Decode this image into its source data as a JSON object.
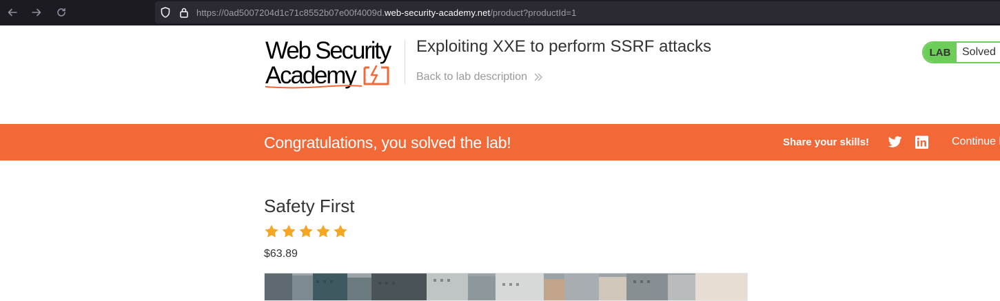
{
  "browser": {
    "url_prefix": "https://0ad5007204d1c71c8552b07e00f4009d.",
    "url_domain": "web-security-academy.net",
    "url_path": "/product?productId=1",
    "icons": [
      "back-arrow-icon",
      "forward-arrow-icon",
      "reload-icon",
      "shield-icon",
      "lock-icon"
    ]
  },
  "header": {
    "logo_line1": "Web Security",
    "logo_line2": "Academy",
    "lab_title": "Exploiting XXE to perform SSRF attacks",
    "back_link": "Back to lab description",
    "lab_badge_label": "LAB",
    "lab_badge_status": "Solved"
  },
  "banner": {
    "message": "Congratulations, you solved the lab!",
    "share_label": "Share your skills!",
    "continue_label": "Continue l",
    "icons": [
      "twitter-icon",
      "linkedin-icon"
    ]
  },
  "product": {
    "title": "Safety First",
    "rating": 5,
    "rating_max": 5,
    "price": "$63.89"
  },
  "colors": {
    "banner": "#f26836",
    "badge_green": "#6ccd59",
    "star": "#f5a623",
    "browser_bg": "#1c1b22",
    "url_bar": "#2b2a33"
  }
}
